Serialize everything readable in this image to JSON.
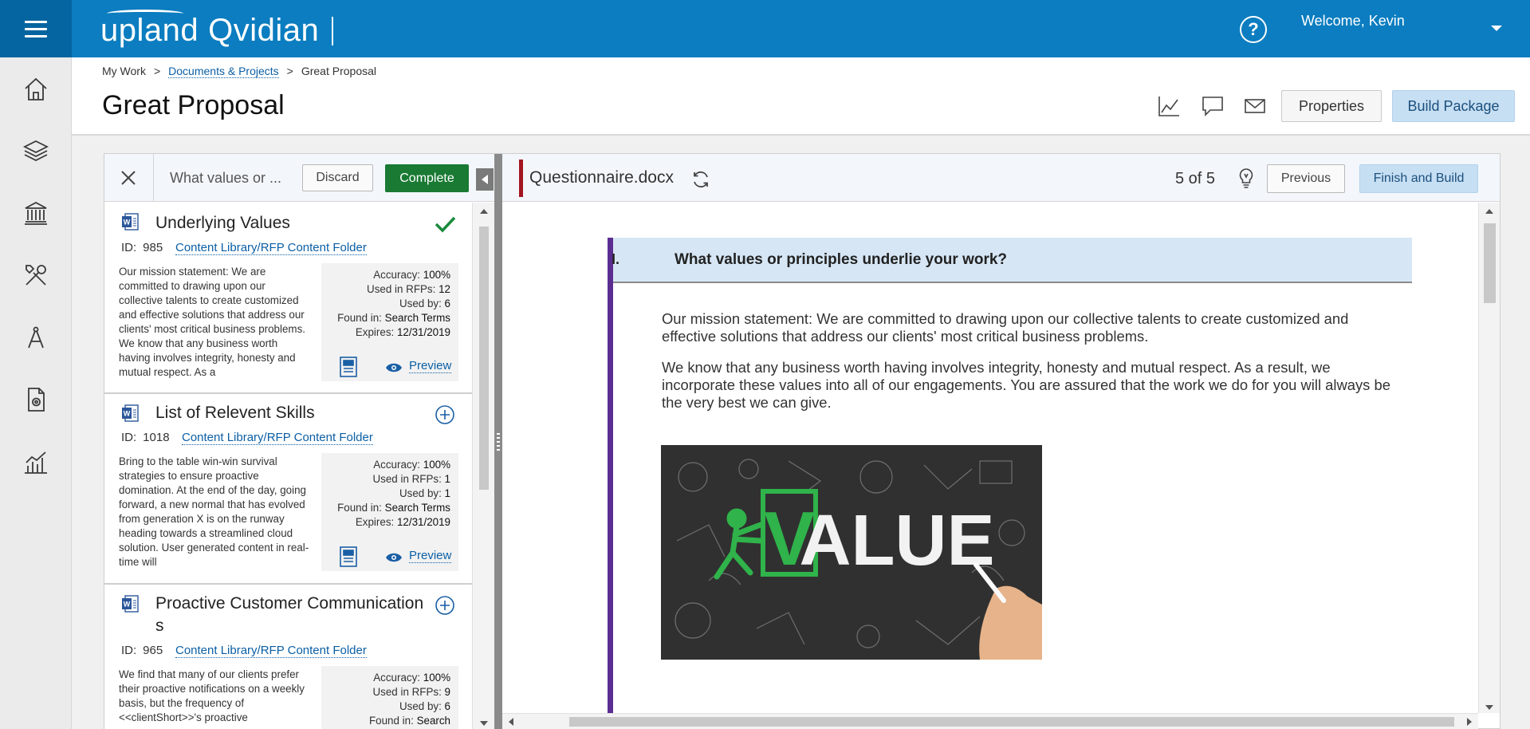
{
  "app": {
    "brand_upland": "upland",
    "brand_product": "Qvidian",
    "welcome": "Welcome, Kevin",
    "help_glyph": "?"
  },
  "nav": {
    "items": [
      {
        "icon": "home-icon"
      },
      {
        "icon": "layers-icon"
      },
      {
        "icon": "library-icon"
      },
      {
        "icon": "tools-icon"
      },
      {
        "icon": "compass-icon"
      },
      {
        "icon": "document-gear-icon"
      },
      {
        "icon": "analytics-icon"
      }
    ]
  },
  "breadcrumb": {
    "root": "My Work",
    "sep": ">",
    "parent": "Documents & Projects",
    "current": "Great Proposal"
  },
  "page": {
    "title": "Great Proposal",
    "properties_label": "Properties",
    "build_label": "Build Package"
  },
  "search_panel": {
    "query": "What values or ...",
    "discard_label": "Discard",
    "complete_label": "Complete"
  },
  "results": [
    {
      "title": "Underlying Values",
      "id_label": "ID:",
      "id": "985",
      "path": "Content Library/RFP Content Folder",
      "snippet": "Our mission statement: We are committed to drawing upon our collective talents to create customized and effective solutions that address our clients' most critical business problems. We know that any business worth having involves integrity, honesty and mutual respect. As a",
      "accuracy_label": "Accuracy:",
      "accuracy": "100%",
      "used_rfps_label": "Used in RFPs:",
      "used_rfps": "12",
      "used_by_label": "Used by:",
      "used_by": "6",
      "found_in_label": "Found in:",
      "found_in": "Search Terms",
      "expires_label": "Expires:",
      "expires": "12/31/2019",
      "preview_label": "Preview",
      "status": "selected"
    },
    {
      "title": "List of Relevent Skills",
      "id_label": "ID:",
      "id": "1018",
      "path": "Content Library/RFP Content Folder",
      "snippet": "Bring to the table win-win survival strategies to ensure proactive domination. At the end of the day, going forward, a new normal that has evolved from generation X is on the runway heading towards a streamlined cloud solution. User generated content in real-time will",
      "accuracy_label": "Accuracy:",
      "accuracy": "100%",
      "used_rfps_label": "Used in RFPs:",
      "used_rfps": "1",
      "used_by_label": "Used by:",
      "used_by": "1",
      "found_in_label": "Found in:",
      "found_in": "Search Terms",
      "expires_label": "Expires:",
      "expires": "12/31/2019",
      "preview_label": "Preview",
      "status": "add"
    },
    {
      "title": "Proactive Customer Communications",
      "id_label": "ID:",
      "id": "965",
      "path": "Content Library/RFP Content Folder",
      "snippet": "We find that many of our clients prefer their proactive notifications on a weekly basis, but the frequency of <<clientShort>>'s proactive",
      "accuracy_label": "Accuracy:",
      "accuracy": "100%",
      "used_rfps_label": "Used in RFPs:",
      "used_rfps": "9",
      "used_by_label": "Used by:",
      "used_by": "6",
      "found_in_label": "Found in:",
      "found_in": "Search",
      "status": "add"
    }
  ],
  "document": {
    "filename": "Questionnaire.docx",
    "position": "5 of 5",
    "previous_label": "Previous",
    "finish_label": "Finish and Build",
    "question_number": "I.",
    "question": "What values or principles underlie your work?",
    "para1": "Our mission statement:  We are committed to drawing upon our collective talents to create customized and effective solutions that address our clients' most critical business problems.",
    "para2": "We know that any business worth having involves integrity, honesty and mutual respect.  As a result, we incorporate these values into all of our engagements.  You are assured that the work we do for you will always be the very best we can give.",
    "image_word": "VALUE"
  },
  "colors": {
    "topbar": "#0b7dc0",
    "complete": "#1a7a34",
    "accent_link": "#0b5fa5",
    "doc_marker": "#a31621",
    "question_bar": "#5c2d91"
  }
}
